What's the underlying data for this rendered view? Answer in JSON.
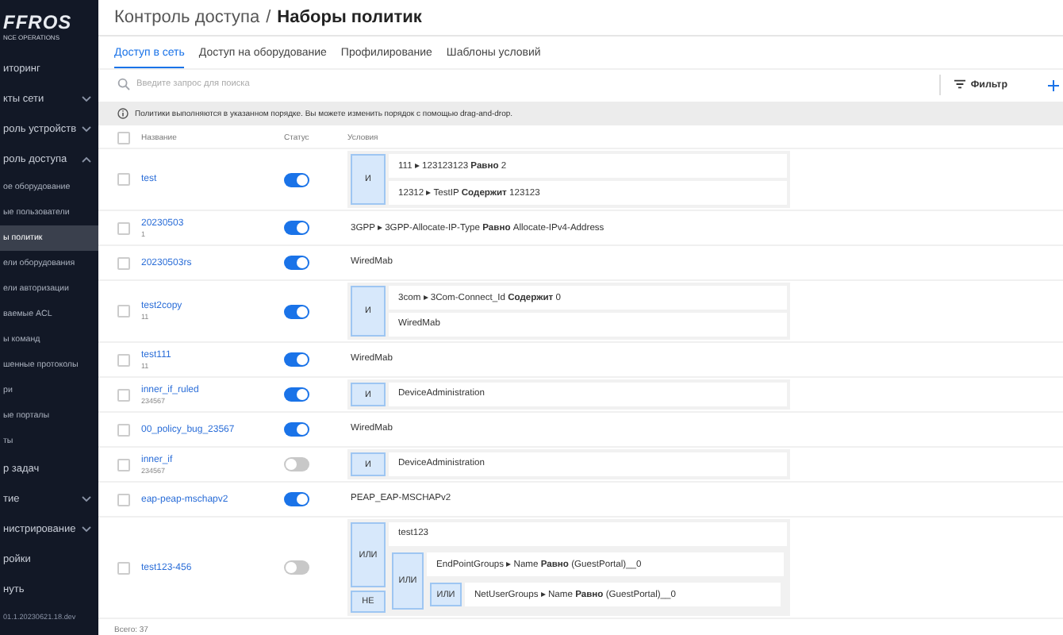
{
  "sidebar": {
    "logo": "FFROS",
    "logo_sub": "NCE OPERATIONS",
    "items": [
      {
        "label": "иторинг",
        "kind": "section",
        "selected": false
      },
      {
        "label": "кты сети",
        "kind": "section",
        "expanded": false,
        "selected": false
      },
      {
        "label": "роль устройств",
        "kind": "section",
        "expanded": false,
        "selected": false
      },
      {
        "label": "роль доступа",
        "kind": "section",
        "expanded": true,
        "selected": false
      },
      {
        "label": "ое оборудование",
        "kind": "sub",
        "selected": false
      },
      {
        "label": "ые пользователи",
        "kind": "sub",
        "selected": false
      },
      {
        "label": "ы политик",
        "kind": "sub",
        "selected": true
      },
      {
        "label": "ели оборудования",
        "kind": "sub",
        "selected": false
      },
      {
        "label": "ели авторизации",
        "kind": "sub",
        "selected": false
      },
      {
        "label": "ваемые ACL",
        "kind": "sub",
        "selected": false
      },
      {
        "label": "ы команд",
        "kind": "sub",
        "selected": false
      },
      {
        "label": "шенные протоколы",
        "kind": "sub",
        "selected": false
      },
      {
        "label": "ри",
        "kind": "sub",
        "selected": false
      },
      {
        "label": "ые порталы",
        "kind": "sub",
        "selected": false
      },
      {
        "label": "ты",
        "kind": "sub",
        "selected": false
      },
      {
        "label": "р задач",
        "kind": "section",
        "selected": false
      },
      {
        "label": "тие",
        "kind": "section",
        "expanded": false,
        "selected": false
      },
      {
        "label": "нистрирование",
        "kind": "section",
        "expanded": false,
        "selected": false
      },
      {
        "label": "ройки",
        "kind": "section",
        "selected": false
      },
      {
        "label": "нуть",
        "kind": "section",
        "selected": false
      }
    ],
    "version": "01.1.20230621.18.dev"
  },
  "breadcrumb": [
    "Контроль доступа",
    "/",
    "Наборы политик"
  ],
  "tabs": [
    {
      "label": "Доступ в сеть",
      "selected": true
    },
    {
      "label": "Доступ на оборудование",
      "selected": false
    },
    {
      "label": "Профилирование",
      "selected": false
    },
    {
      "label": "Шаблоны условий",
      "selected": false
    }
  ],
  "search": {
    "placeholder": "Введите запрос для поиска"
  },
  "filter_button": "Фильтр",
  "info": "Политики выполняются в указанном порядке. Вы можете изменить порядок с помощью drag-and-drop.",
  "table": {
    "all_checked": false,
    "columns": [
      "Название",
      "Статус",
      "Условия"
    ],
    "rows": [
      {
        "name": "test",
        "checked": false,
        "on": true,
        "condition": {
          "kind": "group",
          "op": "И",
          "items": [
            {
              "kind": "leaf",
              "text": "111 ▸ 123123123 **Равно** 2"
            },
            {
              "kind": "leaf",
              "text": "12312 ▸ TestIP **Содержит** 123123"
            }
          ]
        }
      },
      {
        "name": "20230503",
        "checked": false,
        "note": "1",
        "on": true,
        "condition": {
          "kind": "leaf",
          "text": "3GPP ▸ 3GPP-Allocate-IP-Type **Равно** Allocate-IPv4-Address"
        }
      },
      {
        "name": "20230503rs",
        "checked": false,
        "on": true,
        "condition": {
          "kind": "leaf",
          "text": "WiredMab"
        }
      },
      {
        "name": "test2copy",
        "checked": false,
        "note": "11",
        "on": true,
        "condition": {
          "kind": "group",
          "op": "И",
          "items": [
            {
              "kind": "leaf",
              "text": "3com ▸ 3Com-Connect_Id **Содержит** 0"
            },
            {
              "kind": "leaf",
              "text": "WiredMab"
            }
          ]
        }
      },
      {
        "name": "test111",
        "checked": false,
        "note": "11",
        "on": true,
        "condition": {
          "kind": "leaf",
          "text": "WiredMab"
        }
      },
      {
        "name": "inner_if_ruled",
        "checked": false,
        "note": "234567",
        "on": true,
        "condition": {
          "kind": "group",
          "op": "И",
          "items": [
            {
              "kind": "leaf",
              "text": "DeviceAdministration"
            }
          ]
        }
      },
      {
        "name": "00_policy_bug_23567",
        "checked": false,
        "on": true,
        "condition": {
          "kind": "leaf",
          "text": "WiredMab"
        }
      },
      {
        "name": "inner_if",
        "checked": false,
        "note": "234567",
        "on": false,
        "condition": {
          "kind": "group",
          "op": "И",
          "items": [
            {
              "kind": "leaf",
              "text": "DeviceAdministration"
            }
          ]
        }
      },
      {
        "name": "eap-peap-mschapv2",
        "checked": false,
        "on": true,
        "condition": {
          "kind": "leaf",
          "text": "PEAP_EAP-MSCHAPv2"
        }
      },
      {
        "name": "test123-456",
        "checked": false,
        "on": false,
        "condition": {
          "kind": "group",
          "op": "ИЛИ",
          "negation": "НЕ",
          "items": [
            {
              "kind": "leaf",
              "text": "test123"
            },
            {
              "kind": "group",
              "op": "ИЛИ",
              "items": [
                {
                  "kind": "leaf",
                  "text": "EndPointGroups ▸ Name **Равно** (GuestPortal)__0"
                },
                {
                  "kind": "group",
                  "op": "ИЛИ",
                  "items": [
                    {
                      "kind": "leaf",
                      "text": "NetUserGroups ▸ Name **Равно** (GuestPortal)__0"
                    }
                  ]
                }
              ]
            }
          ]
        }
      }
    ]
  },
  "total": "Всего: 37"
}
